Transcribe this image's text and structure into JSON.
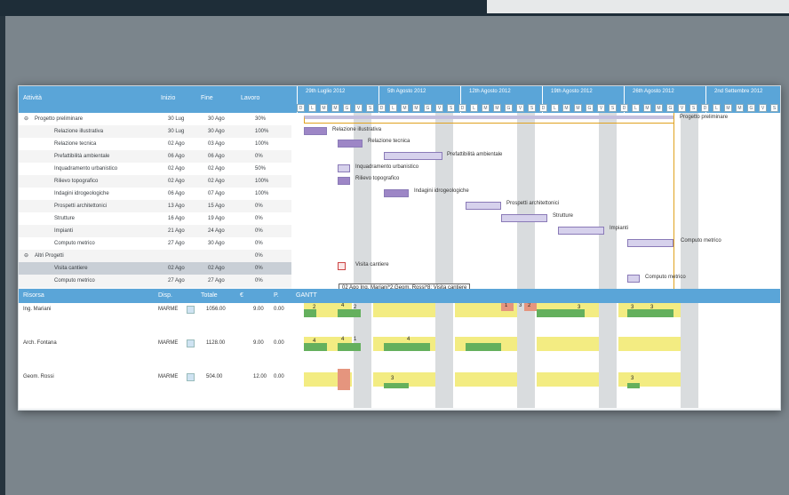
{
  "columns": {
    "activity": "Attività",
    "start": "Inizio",
    "end": "Fine",
    "progress": "Lavoro"
  },
  "weeks": [
    "29th Luglio 2012",
    "5th Agosto 2012",
    "12th Agosto 2012",
    "19th Agosto 2012",
    "26th Agosto 2012",
    "2nd Settembre 2012"
  ],
  "day_letters": [
    "D",
    "L",
    "M",
    "M",
    "G",
    "V",
    "S"
  ],
  "tasks": [
    {
      "name": "Progetto preliminare",
      "start": "30 Lug",
      "end": "30 Ago",
      "pct": "30%"
    },
    {
      "name": "Relazione illustrativa",
      "start": "30 Lug",
      "end": "30 Ago",
      "pct": "100%"
    },
    {
      "name": "Relazione tecnica",
      "start": "02 Ago",
      "end": "03 Ago",
      "pct": "100%"
    },
    {
      "name": "Prefattibilità ambientale",
      "start": "06 Ago",
      "end": "06 Ago",
      "pct": "0%"
    },
    {
      "name": "Inquadramento urbanistico",
      "start": "02 Ago",
      "end": "02 Ago",
      "pct": "50%"
    },
    {
      "name": "Rilievo topografico",
      "start": "02 Ago",
      "end": "02 Ago",
      "pct": "100%"
    },
    {
      "name": "Indagini idrogeologiche",
      "start": "06 Ago",
      "end": "07 Ago",
      "pct": "100%"
    },
    {
      "name": "Prospetti architettonici",
      "start": "13 Ago",
      "end": "15 Ago",
      "pct": "0%"
    },
    {
      "name": "Strutture",
      "start": "16 Ago",
      "end": "19 Ago",
      "pct": "0%"
    },
    {
      "name": "Impianti",
      "start": "21 Ago",
      "end": "24 Ago",
      "pct": "0%"
    },
    {
      "name": "Computo metrico",
      "start": "27 Ago",
      "end": "30 Ago",
      "pct": "0%"
    },
    {
      "name": "Altri Progetti",
      "start": "",
      "end": "",
      "pct": "0%"
    },
    {
      "name": "Visita cantiere",
      "start": "02 Ago",
      "end": "02 Ago",
      "pct": "0%"
    },
    {
      "name": "Computo metrico",
      "start": "27 Ago",
      "end": "27 Ago",
      "pct": "0%"
    }
  ],
  "gantt_labels": {
    "summary": "Progetto preliminare",
    "t1": "Relazione illustrativa",
    "t2": "Relazione tecnica",
    "t3": "Prefattibilità ambientale",
    "t4": "Inquadramento urbanistico",
    "t5": "Rilievo topografico",
    "t6": "Indagini idrogeologiche",
    "t7": "Prospetti architettonici",
    "t8": "Strutture",
    "t9": "Impianti",
    "t10": "Computo metrico",
    "visit": "Visita cantiere",
    "computo2": "Computo metrico"
  },
  "tooltip": "02 Ago Ing. Mariani*2.Geom. Rossi*8: Visita cantiere",
  "resources_header": {
    "name": "Risorsa",
    "code": "Disp.",
    "total": "Totale",
    "cost": "€",
    "rate": "P.",
    "gantt": "GANTT"
  },
  "resources": [
    {
      "name": "Ing. Mariani",
      "code": "MARME",
      "total": "1056.00",
      "cost": "9.00",
      "rate": "0.00"
    },
    {
      "name": "Arch. Fontana",
      "code": "MARME",
      "total": "1128.00",
      "cost": "9.00",
      "rate": "0.00"
    },
    {
      "name": "Geom. Rossi",
      "code": "MARME",
      "total": "504.00",
      "cost": "12.00",
      "rate": "0.00"
    }
  ],
  "colors": {
    "header": "#5aa5d8",
    "workload": "#f3ec82",
    "assigned": "#64b05d",
    "overload": "#e5957e",
    "task": "#d6d1ec"
  }
}
